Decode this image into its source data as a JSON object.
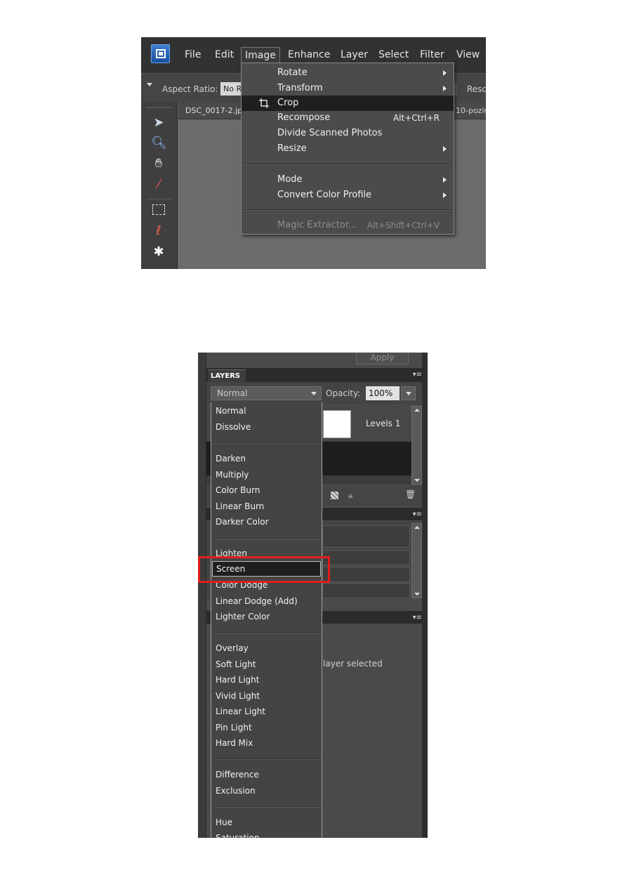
{
  "image_menu_shot": {
    "menubar": [
      "File",
      "Edit",
      "Image",
      "Enhance",
      "Layer",
      "Select",
      "Filter",
      "View"
    ],
    "options": {
      "aspect_label": "Aspect Ratio:",
      "aspect_value": "No R",
      "right_label": "Resc"
    },
    "document_tab": "DSC_0017-2.jp",
    "document_tab_right": "10-pozic",
    "menu_items": [
      {
        "label": "Rotate",
        "shortcut": "",
        "submenu": true
      },
      {
        "label": "Transform",
        "shortcut": "",
        "submenu": true
      },
      {
        "label": "Crop",
        "shortcut": "",
        "submenu": false,
        "highlighted": true
      },
      {
        "label": "Recompose",
        "shortcut": "Alt+Ctrl+R",
        "submenu": false
      },
      {
        "label": "Divide Scanned Photos",
        "shortcut": "",
        "submenu": false
      },
      {
        "label": "Resize",
        "shortcut": "",
        "submenu": true
      },
      {
        "label": "Mode",
        "shortcut": "",
        "submenu": true
      },
      {
        "label": "Convert Color Profile",
        "shortcut": "",
        "submenu": true
      },
      {
        "label": "Magic Extractor...",
        "shortcut": "Alt+Shift+Ctrl+V",
        "submenu": false,
        "disabled": true
      }
    ]
  },
  "layers_shot": {
    "apply_button": "Apply",
    "panel_title": "LAYERS",
    "blend_mode": "Normal",
    "opacity_label": "Opacity:",
    "opacity_value": "100%",
    "layer_name": "Levels 1",
    "no_layer_text": "layer selected",
    "blend_modes": [
      [
        "Normal",
        "Dissolve"
      ],
      [
        "Darken",
        "Multiply",
        "Color Burn",
        "Linear Burn",
        "Darker Color"
      ],
      [
        "Lighten",
        "Screen",
        "Color Dodge",
        "Linear Dodge (Add)",
        "Lighter Color"
      ],
      [
        "Overlay",
        "Soft Light",
        "Hard Light",
        "Vivid Light",
        "Linear Light",
        "Pin Light",
        "Hard Mix"
      ],
      [
        "Difference",
        "Exclusion"
      ],
      [
        "Hue",
        "Saturation"
      ]
    ],
    "highlighted_mode": "Screen",
    "highlight_color": "#e11d1d"
  }
}
